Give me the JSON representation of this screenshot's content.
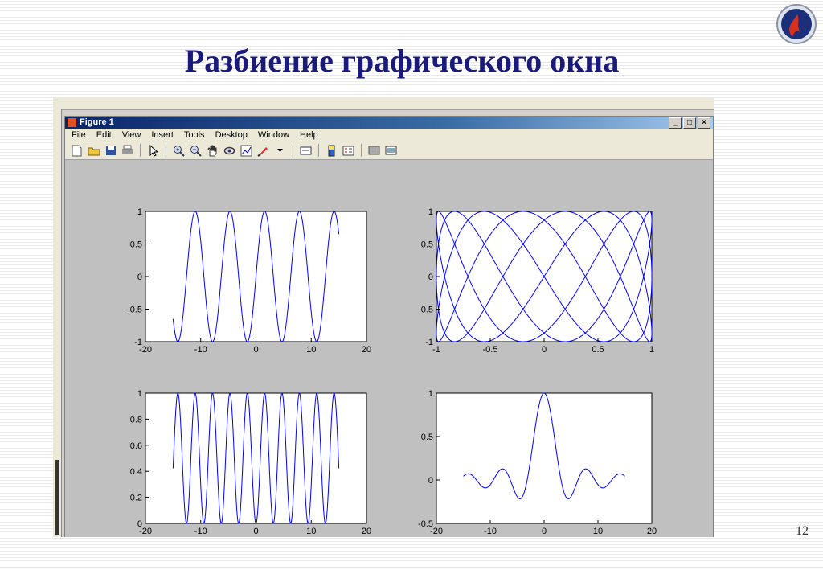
{
  "slide": {
    "title": "Разбиение графического окна",
    "page_number": "12"
  },
  "window": {
    "title": "Figure 1",
    "menu": [
      "File",
      "Edit",
      "View",
      "Insert",
      "Tools",
      "Desktop",
      "Window",
      "Help"
    ],
    "buttons": {
      "minimize": "_",
      "maximize": "□",
      "close": "×"
    },
    "toolbar_icons": [
      "new-figure-icon",
      "open-file-icon",
      "save-icon",
      "print-icon",
      "edit-plot-arrow-icon",
      "zoom-in-icon",
      "zoom-out-icon",
      "pan-hand-icon",
      "rotate-3d-icon",
      "data-cursor-icon",
      "brush-icon",
      "link-icon",
      "colorbar-icon",
      "legend-icon",
      "hide-plot-tools-icon",
      "show-plot-tools-icon"
    ]
  },
  "chart_data": [
    {
      "type": "line",
      "title": "",
      "xlim": [
        -20,
        20
      ],
      "ylim": [
        -1,
        1
      ],
      "xticks": [
        "-20",
        "-10",
        "0",
        "10",
        "20"
      ],
      "yticks": [
        "1",
        "0.5",
        "0",
        "-0.5",
        "-1"
      ],
      "series": [
        {
          "function": "sin(x)",
          "x_range": [
            -15,
            15
          ],
          "color": "#0000ff"
        }
      ]
    },
    {
      "type": "line",
      "title": "",
      "xlim": [
        -1,
        1
      ],
      "ylim": [
        -1,
        1
      ],
      "xticks": [
        "-1",
        "-0.5",
        "0",
        "0.5",
        "1"
      ],
      "yticks": [
        "1",
        "0.5",
        "0",
        "-0.5",
        "-1"
      ],
      "series": [
        {
          "function": "parametric Lissajous",
          "color": "#0000ff"
        }
      ]
    },
    {
      "type": "line",
      "title": "",
      "xlim": [
        -20,
        20
      ],
      "ylim": [
        0,
        1
      ],
      "xticks": [
        "-20",
        "-10",
        "0",
        "10",
        "20"
      ],
      "yticks": [
        "1",
        "0.8",
        "0.6",
        "0.4",
        "0.2",
        "0"
      ],
      "series": [
        {
          "function": "sin(x)^2",
          "x_range": [
            -15,
            15
          ],
          "color": "#0000ff"
        }
      ]
    },
    {
      "type": "line",
      "title": "",
      "xlim": [
        -20,
        20
      ],
      "ylim": [
        -0.5,
        1
      ],
      "xticks": [
        "-20",
        "-10",
        "0",
        "10",
        "20"
      ],
      "yticks": [
        "1",
        "0.5",
        "0",
        "-0.5"
      ],
      "series": [
        {
          "function": "sin(x)/x",
          "x_range": [
            -15,
            15
          ],
          "color": "#0000ff"
        }
      ]
    }
  ]
}
